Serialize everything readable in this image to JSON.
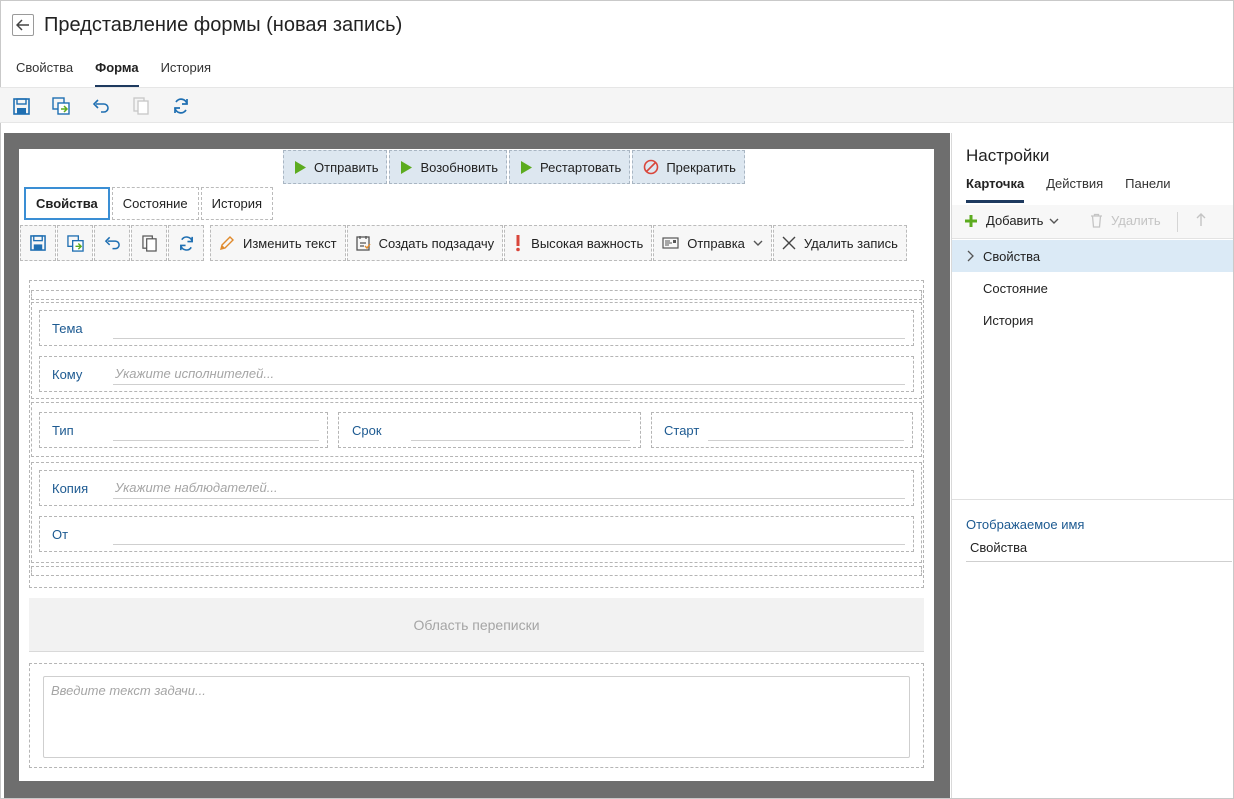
{
  "header": {
    "title": "Представление формы (новая запись)",
    "tabs": [
      "Свойства",
      "Форма",
      "История"
    ],
    "active_tab": "Форма",
    "toolbar_icons": [
      "save-icon",
      "save-as-icon",
      "undo-icon",
      "copy-icon",
      "refresh-icon"
    ]
  },
  "form": {
    "action_buttons": [
      "Отправить",
      "Возобновить",
      "Рестартовать",
      "Прекратить"
    ],
    "tabs": [
      "Свойства",
      "Состояние",
      "История"
    ],
    "active_tab": "Свойства",
    "toolbar": {
      "edit_text": "Изменить текст",
      "create_subtask": "Создать подзадачу",
      "high_priority": "Высокая важность",
      "send": "Отправка",
      "delete_record": "Удалить запись"
    },
    "fields": {
      "subject": {
        "label": "Тема"
      },
      "to": {
        "label": "Кому",
        "placeholder": "Укажите исполнителей..."
      },
      "type": {
        "label": "Тип"
      },
      "deadline": {
        "label": "Срок"
      },
      "start": {
        "label": "Старт"
      },
      "copy": {
        "label": "Копия",
        "placeholder": "Укажите наблюдателей..."
      },
      "from": {
        "label": "От"
      }
    },
    "correspondence_area": "Область переписки",
    "task_text_placeholder": "Введите текст задачи..."
  },
  "settings": {
    "title": "Настройки",
    "tabs": [
      "Карточка",
      "Действия",
      "Панели"
    ],
    "active_tab": "Карточка",
    "add_label": "Добавить",
    "delete_label": "Удалить",
    "tree": [
      "Свойства",
      "Состояние",
      "История"
    ],
    "selected_item": "Свойства",
    "display_name_label": "Отображаемое имя",
    "display_name_value": "Свойства"
  },
  "colors": {
    "accent": "#1e3a5f",
    "link_label": "#1d5a91",
    "selected_row": "#dbeaf6",
    "play_green": "#5cab1f",
    "stop_red": "#d9463b",
    "action_bg": "#dde7f0",
    "canvas_gray": "#6e6e6e"
  }
}
